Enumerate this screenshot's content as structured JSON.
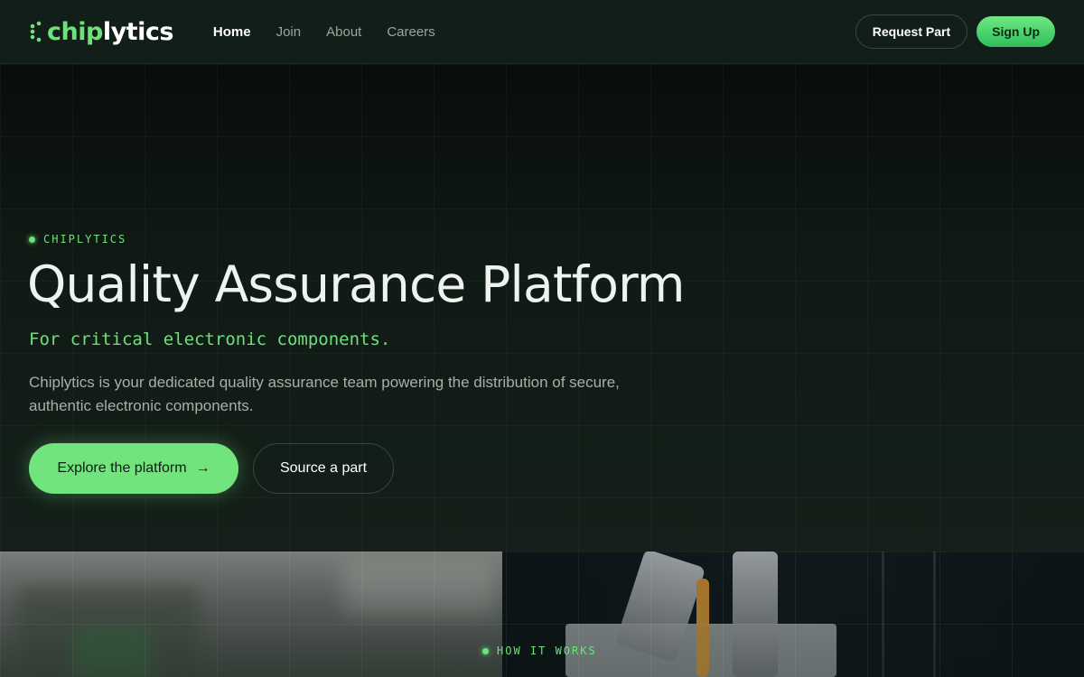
{
  "header": {
    "logo_accent": "chip",
    "logo_rest": "lytics",
    "nav": [
      {
        "label": "Home",
        "active": true
      },
      {
        "label": "Join",
        "active": false
      },
      {
        "label": "About",
        "active": false
      },
      {
        "label": "Careers",
        "active": false
      }
    ],
    "request_label": "Request Part",
    "signup_label": "Sign Up"
  },
  "hero": {
    "eyebrow": "CHIPLYTICS",
    "title": "Quality Assurance Platform",
    "subtitle": "For critical electronic components.",
    "description": "Chiplytics is your dedicated quality assurance team powering the distribution of secure, authentic electronic components.",
    "primary_cta": "Explore the platform",
    "primary_cta_icon": "arrow-right-icon",
    "secondary_cta": "Source a part"
  },
  "section": {
    "eyebrow": "HOW IT WORKS"
  },
  "colors": {
    "accent": "#6fe07a",
    "background": "#0b1410",
    "header": "#121e18"
  }
}
